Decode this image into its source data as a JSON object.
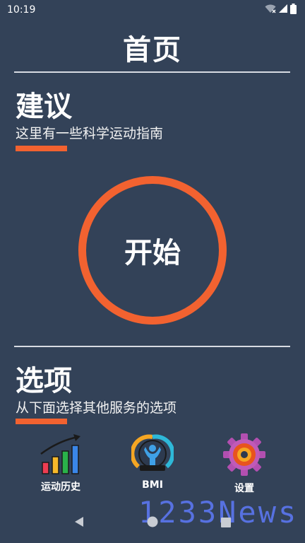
{
  "status_bar": {
    "time": "10:19",
    "icons": [
      "wifi-icon",
      "signal-icon",
      "battery-icon"
    ]
  },
  "header": {
    "title": "首页"
  },
  "suggestion": {
    "title": "建议",
    "subtitle": "这里有一些科学运动指南"
  },
  "start": {
    "label": "开始"
  },
  "options": {
    "title": "选项",
    "subtitle": "从下面选择其他服务的选项",
    "items": [
      {
        "label": "运动历史",
        "icon": "bar-chart-icon"
      },
      {
        "label": "BMI",
        "icon": "bmi-gauge-icon"
      },
      {
        "label": "设置",
        "icon": "gear-icon"
      }
    ]
  },
  "watermark": {
    "text": "1233News"
  },
  "nav": {
    "items": [
      "back-icon",
      "home-icon",
      "recents-icon"
    ]
  },
  "colors": {
    "background": "#334258",
    "accent": "#f26230",
    "divider": "#d7dbe2"
  }
}
